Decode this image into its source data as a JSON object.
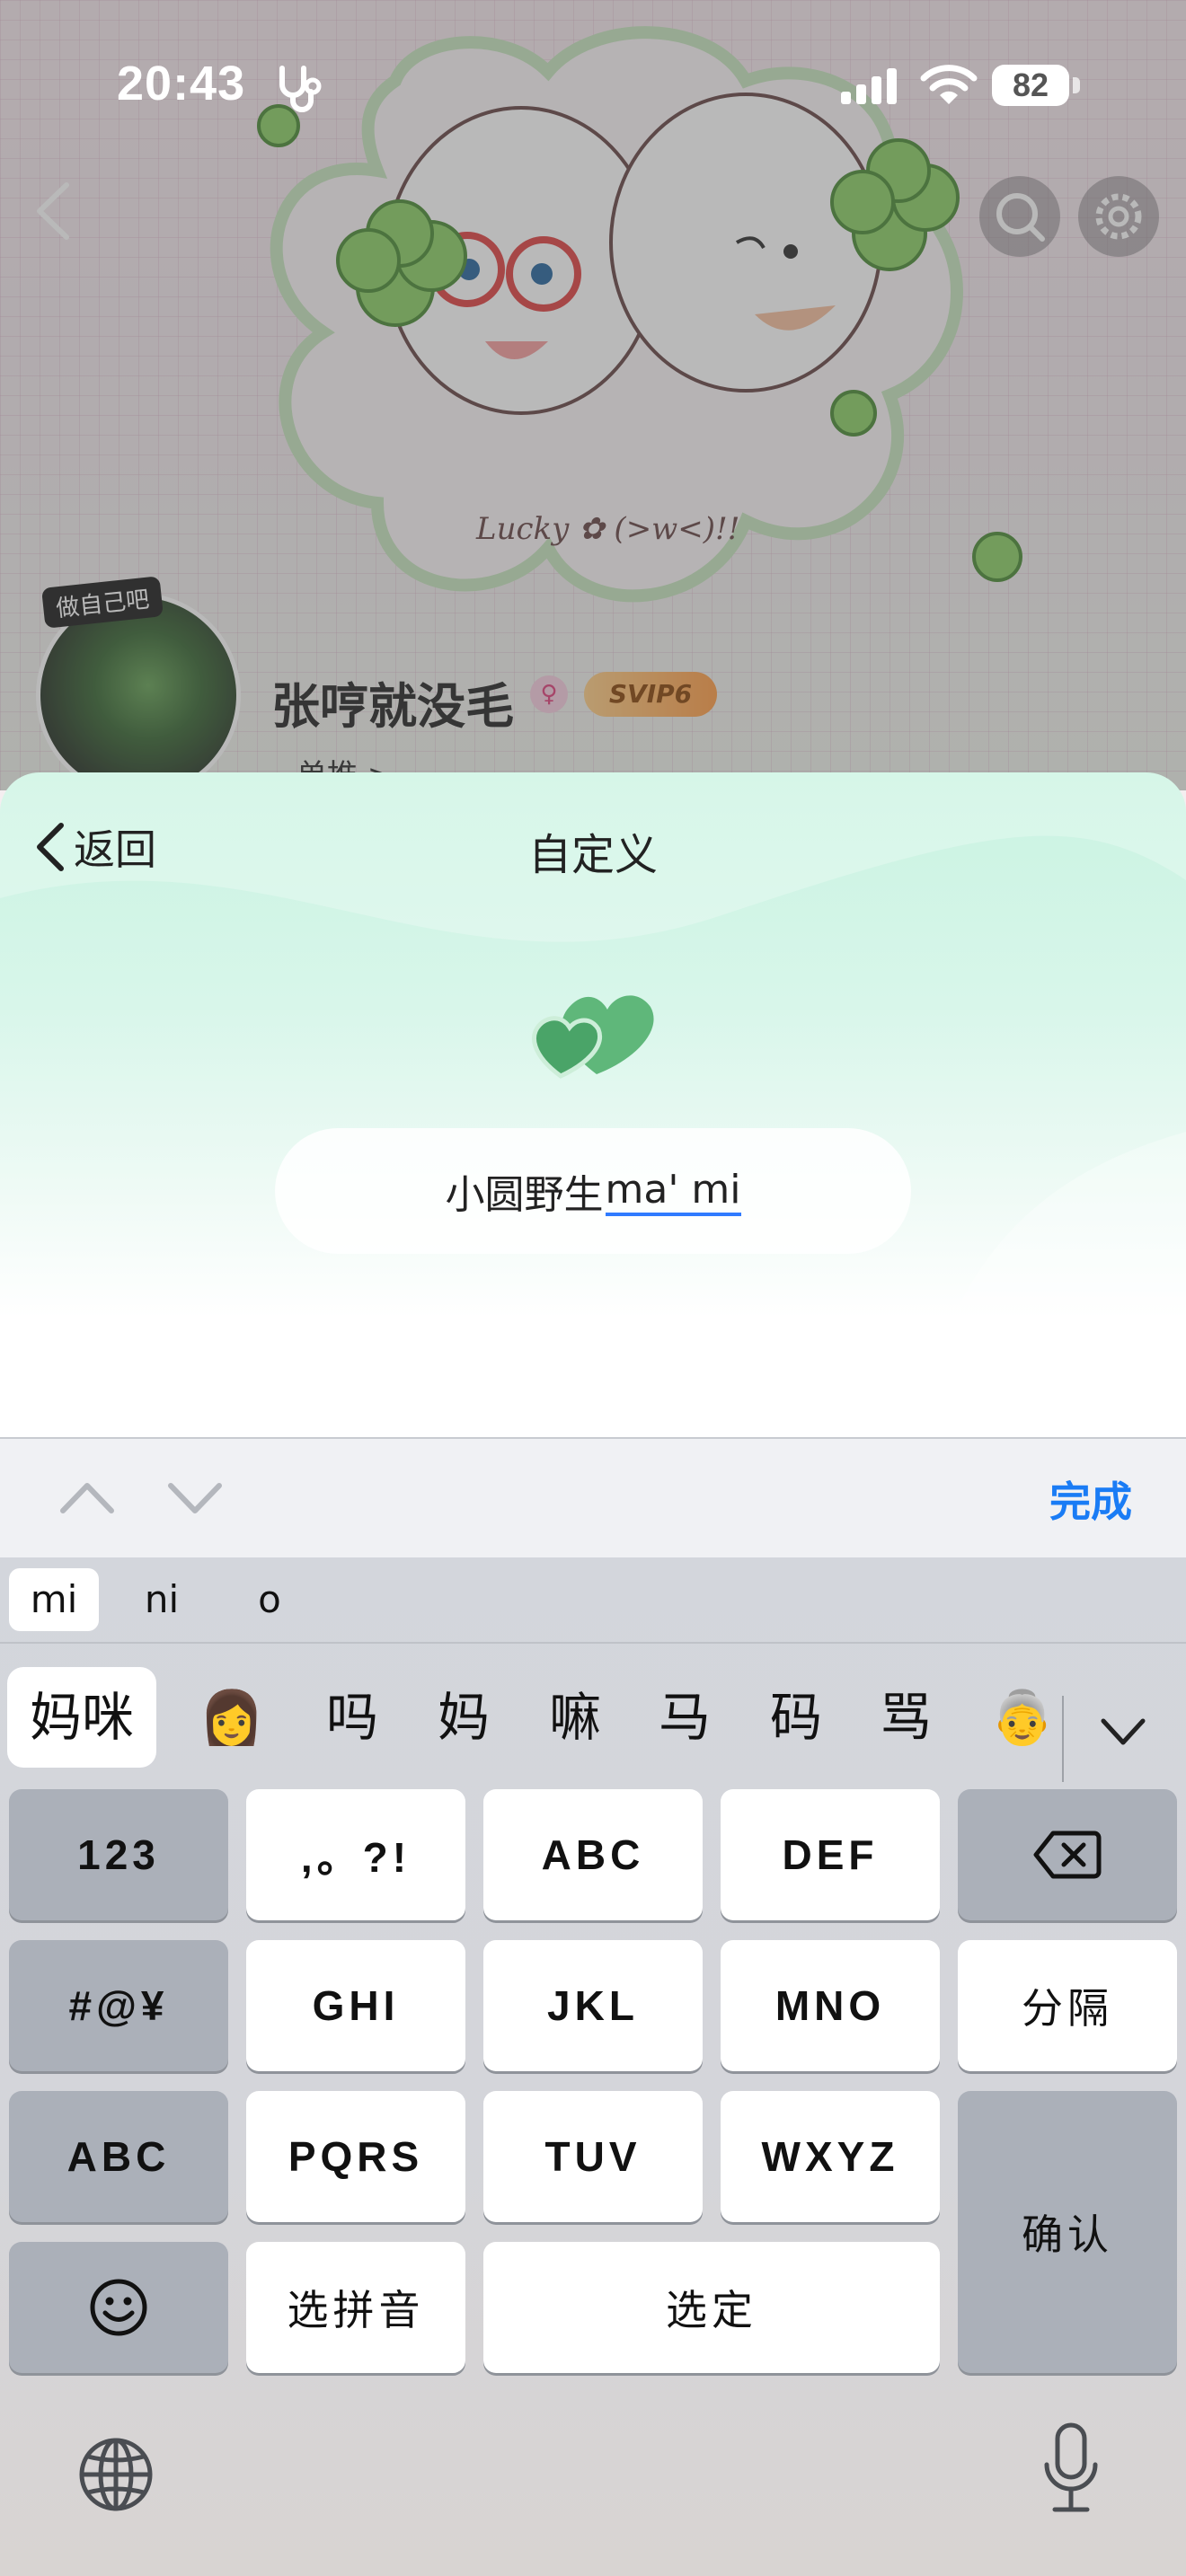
{
  "status_bar": {
    "time": "20:43",
    "battery": "82"
  },
  "profile": {
    "avatar_tag": "做自己吧",
    "name": "张哼就没毛",
    "gender_symbol": "♀",
    "vip_badge": "SVIP6",
    "subline": "单推 >"
  },
  "sheet": {
    "back_label": "返回",
    "title": "自定义",
    "input": {
      "committed_text": "小圆野生",
      "marked_text": "ma' mi"
    }
  },
  "keyboard": {
    "done_label": "完成",
    "pinyin_options": [
      "mi",
      "ni",
      "o"
    ],
    "candidates": [
      "妈咪",
      "👩",
      "吗",
      "妈",
      "嘛",
      "马",
      "码",
      "骂",
      "👵"
    ],
    "keys": {
      "num": "123",
      "punct": ",。?!",
      "abc": "ABC",
      "def": "DEF",
      "symbols": "#@¥",
      "ghi": "GHI",
      "jkl": "JKL",
      "mno": "MNO",
      "separator": "分隔",
      "abc_mode": "ABC",
      "pqrs": "PQRS",
      "tuv": "TUV",
      "wxyz": "WXYZ",
      "confirm": "确认",
      "choose_pinyin": "选拼音",
      "select": "选定"
    }
  },
  "colors": {
    "accent_blue": "#1a7cf5",
    "sheet_mint": "#c9f3e1",
    "heart_green": "#5fb77a"
  }
}
